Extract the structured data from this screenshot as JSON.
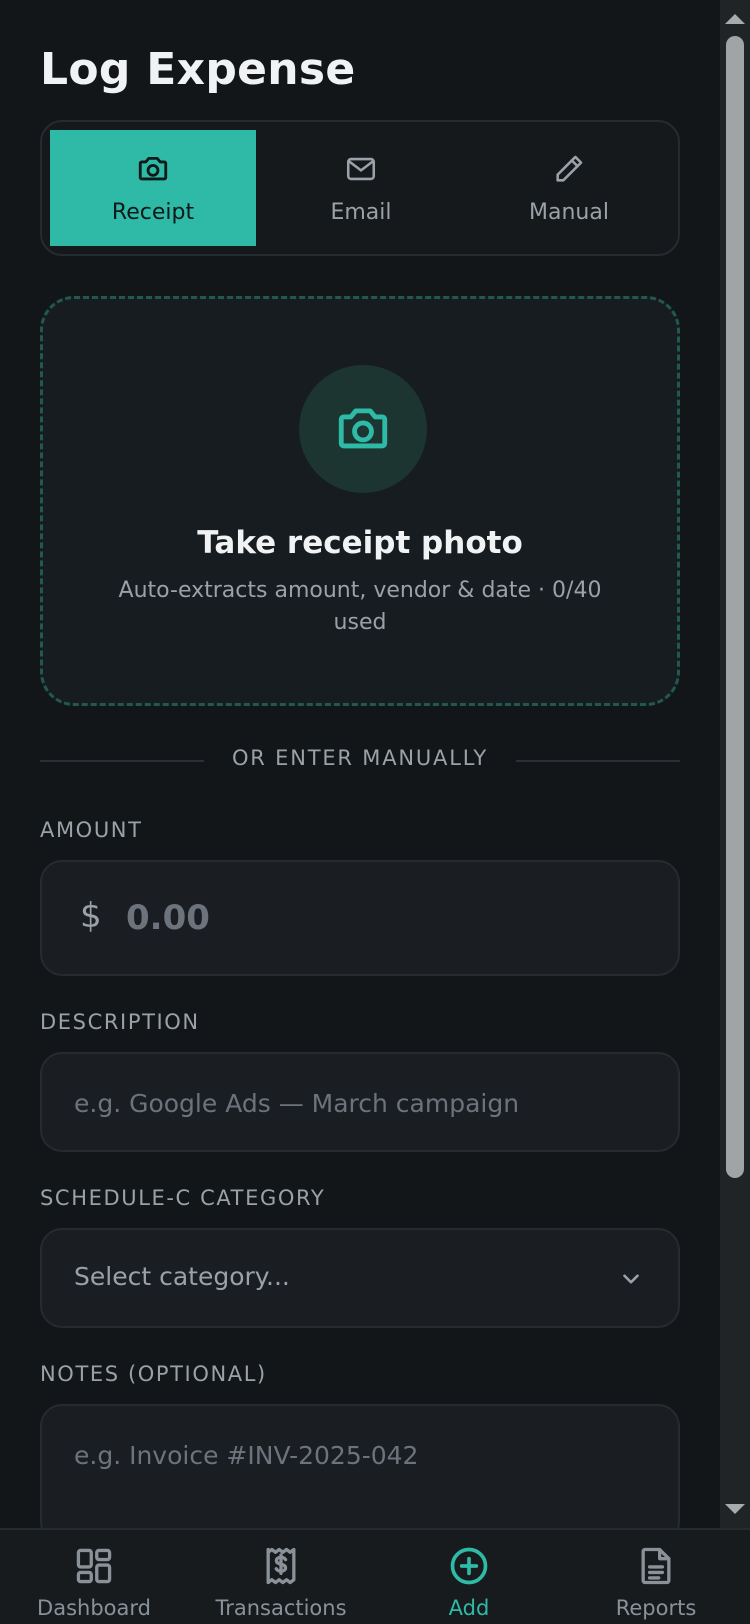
{
  "page": {
    "title": "Log Expense"
  },
  "tabs": [
    {
      "label": "Receipt",
      "icon": "camera-icon",
      "active": true
    },
    {
      "label": "Email",
      "icon": "mail-icon",
      "active": false
    },
    {
      "label": "Manual",
      "icon": "pencil-icon",
      "active": false
    }
  ],
  "dropzone": {
    "title": "Take receipt photo",
    "subtitle": "Auto-extracts amount, vendor & date · 0/40 used"
  },
  "divider": {
    "label": "OR ENTER MANUALLY"
  },
  "amount": {
    "label": "AMOUNT",
    "currency": "$",
    "placeholder": "0.00"
  },
  "description": {
    "label": "DESCRIPTION",
    "placeholder": "e.g. Google Ads — March campaign"
  },
  "category": {
    "label": "SCHEDULE-C CATEGORY",
    "placeholder": "Select category..."
  },
  "notes": {
    "label": "NOTES (OPTIONAL)",
    "placeholder": "e.g. Invoice #INV-2025-042"
  },
  "nav": [
    {
      "label": "Dashboard",
      "icon": "grid-icon"
    },
    {
      "label": "Transactions",
      "icon": "receipt-icon"
    },
    {
      "label": "Add",
      "icon": "plus-circle-icon",
      "active": true
    },
    {
      "label": "Reports",
      "icon": "document-icon"
    }
  ],
  "colors": {
    "accent": "#2ebaa6",
    "background": "#121619",
    "surface": "#1a1e22"
  }
}
